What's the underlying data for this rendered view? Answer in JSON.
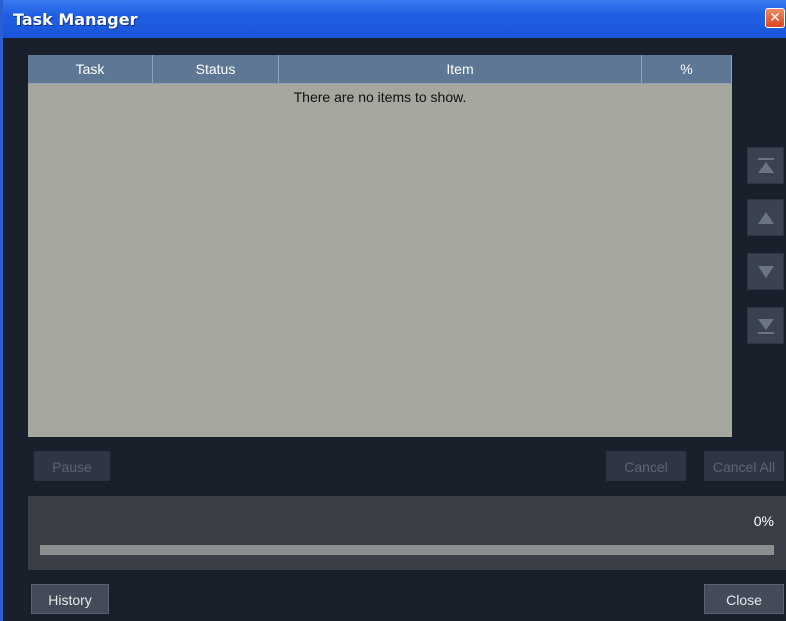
{
  "window": {
    "title": "Task Manager",
    "close_glyph": "✕"
  },
  "table": {
    "columns": [
      "Task",
      "Status",
      "Item",
      "%"
    ],
    "empty_message": "There are no items to show."
  },
  "side_buttons": [
    {
      "icon": "move-to-top-icon"
    },
    {
      "icon": "move-up-icon"
    },
    {
      "icon": "move-down-icon"
    },
    {
      "icon": "move-to-bottom-icon"
    }
  ],
  "actions": {
    "pause": "Pause",
    "cancel": "Cancel",
    "cancel_all": "Cancel All",
    "history": "History",
    "close": "Close"
  },
  "progress": {
    "percent_label": "0%",
    "value": 0
  },
  "colors": {
    "titlebar": "#1f5fe3",
    "table_body": "#a3a79e",
    "header": "#5e7794",
    "background": "#19202c"
  }
}
